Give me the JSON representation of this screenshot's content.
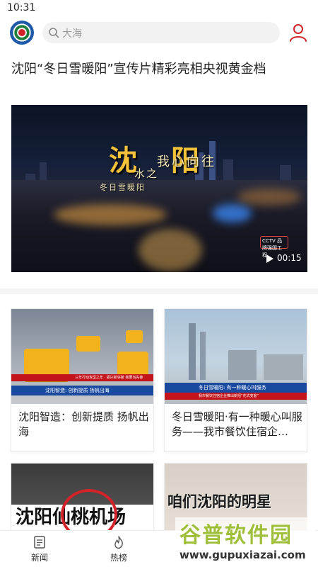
{
  "status_bar": {
    "time": "10:31"
  },
  "header": {
    "search_placeholder": "大海"
  },
  "headline": "沈阳“冬日雪暖阳”宣传片精彩亮相央视黄金档",
  "video": {
    "title_main": "沈",
    "title_main_2": "阳",
    "title_sub": "我心向往",
    "title_sub_2": "水之",
    "title_left": "冬日雪暖阳",
    "badge": "CCTV 品牌强国工程",
    "duration": "00:15"
  },
  "cards": [
    {
      "title": "沈阳智造：创新提质 扬帆出海",
      "thumb_caption": "沈阳智造: 创新提质 扬帆出海",
      "thumb_ticker": "三年行动攻坚之年 · 振兴新突破 我要当先锋"
    },
    {
      "title": "冬日雪暖阳·有一种暖心叫服务——我市餐饮住宿企…",
      "thumb_caption": "冬日雪暖阳: 有一种暖心叫服务",
      "thumb_ticker": "我市餐饮住宿企业推出新招“花式变客”"
    },
    {
      "title": "",
      "thumb_caption": "沈阳仙桃机场"
    },
    {
      "title": "",
      "thumb_caption": "咱们沈阳的明星"
    }
  ],
  "bottom_nav": {
    "items": [
      {
        "label": "新闻",
        "icon": "news-icon"
      },
      {
        "label": "热榜",
        "icon": "flame-icon"
      }
    ]
  },
  "watermark": {
    "main": "谷普软件园",
    "url": "www.gupuxiazai.com"
  },
  "colors": {
    "accent_red": "#d2232a",
    "brand_green": "#1f7d3a",
    "brand_blue": "#1e5aa8"
  }
}
